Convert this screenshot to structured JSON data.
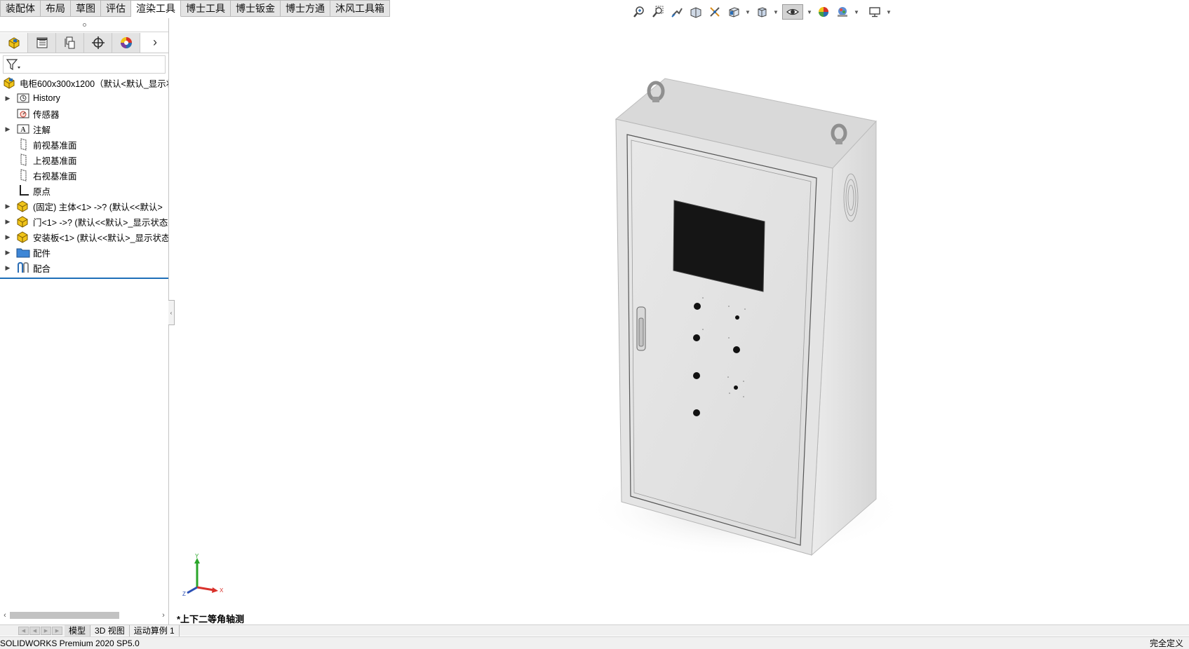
{
  "command_tabs": [
    {
      "label": "装配体",
      "active": false
    },
    {
      "label": "布局",
      "active": false
    },
    {
      "label": "草图",
      "active": false
    },
    {
      "label": "评估",
      "active": false
    },
    {
      "label": "渲染工具",
      "active": true
    },
    {
      "label": "博士工具",
      "active": false
    },
    {
      "label": "博士钣金",
      "active": false
    },
    {
      "label": "博士方通",
      "active": false
    },
    {
      "label": "沐风工具箱",
      "active": false
    }
  ],
  "hud_toolbar": [
    "zoom-to-fit-icon",
    "zoom-to-area-icon",
    "previous-view-icon",
    "section-view-icon",
    "dynamic-annotation-icon",
    "view-orientation-icon",
    "display-style-icon",
    "hide-show-items-icon",
    "edit-appearance-icon",
    "apply-scene-icon",
    "view-settings-icon"
  ],
  "feature_tree": {
    "root": "电柜600x300x1200（默认<默认_显示状",
    "items": [
      {
        "label": "History",
        "icon": "history-icon",
        "expandable": true
      },
      {
        "label": "传感器",
        "icon": "sensor-icon",
        "expandable": false
      },
      {
        "label": "注解",
        "icon": "annotation-icon",
        "expandable": true
      },
      {
        "label": "前视基准面",
        "icon": "plane-icon",
        "expandable": false
      },
      {
        "label": "上视基准面",
        "icon": "plane-icon",
        "expandable": false
      },
      {
        "label": "右视基准面",
        "icon": "plane-icon",
        "expandable": false
      },
      {
        "label": "原点",
        "icon": "origin-icon",
        "expandable": false
      },
      {
        "label": "(固定) 主体<1> ->? (默认<<默认>",
        "icon": "part-icon",
        "expandable": true
      },
      {
        "label": "门<1> ->? (默认<<默认>_显示状态",
        "icon": "part-icon",
        "expandable": true
      },
      {
        "label": "安装板<1> (默认<<默认>_显示状态",
        "icon": "part-icon",
        "expandable": true
      },
      {
        "label": "配件",
        "icon": "folder-icon",
        "expandable": true
      },
      {
        "label": "配合",
        "icon": "mates-icon",
        "expandable": true
      }
    ]
  },
  "viewport": {
    "view_label": "*上下二等角轴测",
    "triad": {
      "x": "X",
      "y": "Y",
      "z": "Z"
    }
  },
  "bottom_tabs": [
    {
      "label": "模型",
      "active": true
    },
    {
      "label": "3D 视图",
      "active": false
    },
    {
      "label": "运动算例 1",
      "active": false
    }
  ],
  "status": {
    "product": "SOLIDWORKS Premium 2020 SP5.0",
    "state": "完全定义"
  },
  "colors": {
    "accent": "#1e6fb8",
    "panel_tab": "#e3e3e3",
    "cabinet": "#e6e6e6"
  }
}
